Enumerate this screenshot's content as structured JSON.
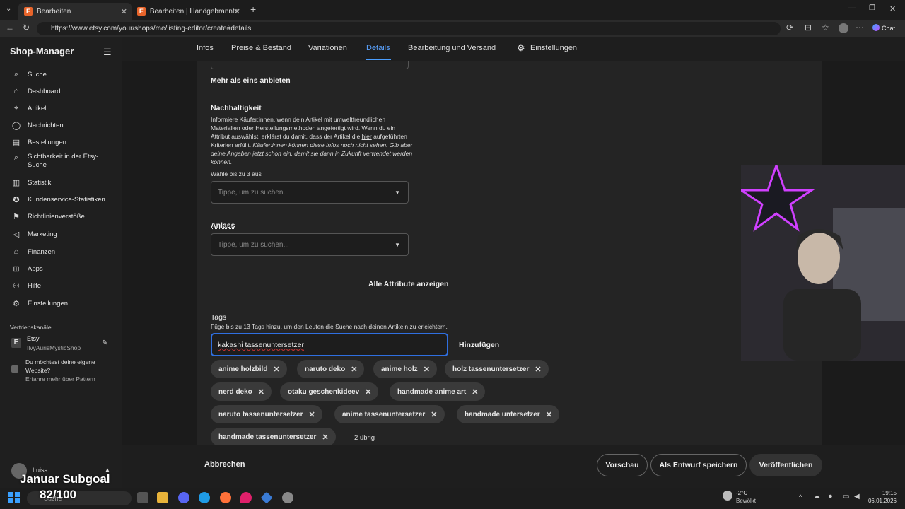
{
  "browser": {
    "tabs": [
      {
        "label": "Bearbeiten"
      },
      {
        "label": "Bearbeiten | Handgebrannter Kaka"
      }
    ],
    "url": "https://www.etsy.com/your/shops/me/listing-editor/create#details",
    "chat_label": "Chat"
  },
  "sidebar": {
    "title": "Shop-Manager",
    "items": [
      {
        "label": "Suche",
        "icon": "search-icon"
      },
      {
        "label": "Dashboard",
        "icon": "home-icon"
      },
      {
        "label": "Artikel",
        "icon": "tag-icon"
      },
      {
        "label": "Nachrichten",
        "icon": "chat-icon"
      },
      {
        "label": "Bestellungen",
        "icon": "list-icon"
      },
      {
        "label": "Sichtbarkeit in der Etsy-",
        "label2": "Suche",
        "icon": "search-icon"
      },
      {
        "label": "Statistik",
        "icon": "chart-icon"
      },
      {
        "label": "Kundenservice-Statistiken",
        "icon": "badge-icon"
      },
      {
        "label": "Richtlinienverstöße",
        "icon": "flag-icon"
      },
      {
        "label": "Marketing",
        "icon": "megaphone-icon"
      },
      {
        "label": "Finanzen",
        "icon": "bank-icon"
      },
      {
        "label": "Apps",
        "icon": "grid-icon"
      },
      {
        "label": "Hilfe",
        "icon": "people-icon"
      },
      {
        "label": "Einstellungen",
        "icon": "gear-icon"
      }
    ],
    "channels_heading": "Vertriebskanäle",
    "shop_channel": "Etsy",
    "shop_name": "IlvyAurisMysticShop",
    "pattern_q1": "Du möchtest deine eigene",
    "pattern_q2": "Website?",
    "pattern_link": "Erfahre mehr über Pattern",
    "user_name": "Luisa"
  },
  "nav": {
    "tabs": [
      "Infos",
      "Preise & Bestand",
      "Variationen",
      "Details",
      "Bearbeitung und Versand",
      "Einstellungen"
    ],
    "active": "Details"
  },
  "form": {
    "more_label": "Mehr als eins anbieten",
    "sustain_title": "Nachhaltigkeit",
    "sustain_l1": "Informiere Käufer:innen, wenn dein Artikel mit umweltfreundlichen",
    "sustain_l2": "Materialien oder Herstellungsmethoden angefertigt wird. Wenn du ein",
    "sustain_l3a": "Attribut auswählst, erklärst du damit, dass der Artikel die ",
    "sustain_link": "hier",
    "sustain_l3b": " aufgeführten",
    "sustain_l4a": "Kriterien erfüllt. ",
    "sustain_l4b": "Käufer:innen können diese Infos noch nicht sehen. Gib aber",
    "sustain_l5": "deine Angaben jetzt schon ein, damit sie dann in Zukunft verwendet werden",
    "sustain_l6": "können.",
    "choose_up_to": "Wähle bis zu 3 aus",
    "select_placeholder": "Tippe, um zu suchen...",
    "occasion_title": "Anlass",
    "all_attrs": "Alle Attribute anzeigen",
    "tags_title": "Tags",
    "tags_help": "Füge bis zu 13 Tags hinzu, um den Leuten die Suche nach deinen Artikeln zu erleichtern.",
    "tag_input": "kakashi tassenuntersetzer",
    "add_label": "Hinzufügen",
    "tags": [
      "anime holzbild",
      "naruto deko",
      "anime holz",
      "holz tassenuntersetzer",
      "nerd deko",
      "otaku geschenkideev",
      "handmade anime art",
      "naruto tassenuntersetzer",
      "anime tassenuntersetzer",
      "handmade untersetzer",
      "handmade tassenuntersetzer"
    ],
    "remaining": "2 übrig"
  },
  "footer": {
    "cancel": "Abbrechen",
    "preview": "Vorschau",
    "draft": "Als Entwurf speichern",
    "publish": "Veröffentlichen"
  },
  "overlay": {
    "subgoal": "Januar Subgoal",
    "progress": "82/100"
  },
  "taskbar": {
    "weather_temp": "-2°C",
    "weather_desc": "Bewölkt",
    "time": "19:15",
    "date": "06.01.2026",
    "search": "Suche"
  },
  "colors": {
    "active_tab": "#4a9eff",
    "accent_input": "#2f6fe0"
  }
}
